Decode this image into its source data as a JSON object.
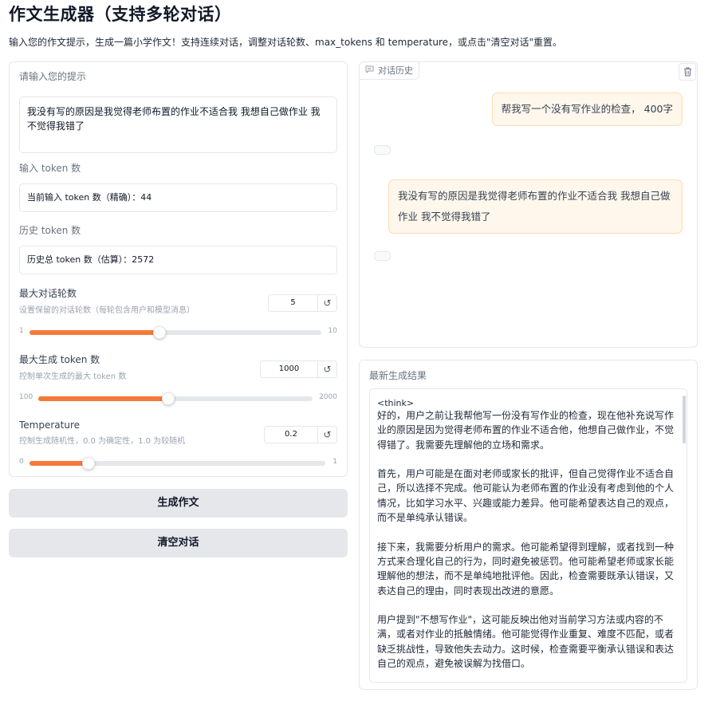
{
  "header": {
    "title": "作文生成器（支持多轮对话）",
    "subtitle": "输入您的作文提示，生成一篇小学作文！支持连续对话，调整对话轮数、max_tokens 和 temperature，或点击\"清空对话\"重置。"
  },
  "prompt": {
    "label": "请输入您的提示",
    "value": "我没有写的原因是我觉得老师布置的作业不适合我 我想自己做作业 我不觉得我错了"
  },
  "input_tokens": {
    "label": "输入 token 数",
    "value": "当前输入 token 数（精确）：44"
  },
  "history_tokens": {
    "label": "历史 token 数",
    "value": "历史总 token 数（估算）：2572"
  },
  "sliders": [
    {
      "label": "最大对话轮数",
      "info": "设置保留的对话轮数（每轮包含用户和模型消息）",
      "value": "5",
      "min": "1",
      "max": "10",
      "fraction": 0.4444
    },
    {
      "label": "最大生成 token 数",
      "info": "控制单次生成的最大 token 数",
      "value": "1000",
      "min": "100",
      "max": "2000",
      "fraction": 0.4737
    },
    {
      "label": "Temperature",
      "info": "控制生成随机性，0.0 为确定性，1.0 为较随机",
      "value": "0.2",
      "min": "0",
      "max": "1",
      "fraction": 0.2
    }
  ],
  "buttons": {
    "generate": "生成作文",
    "clear": "清空对话"
  },
  "chat": {
    "label": "对话历史",
    "icons": {
      "tag": "chat-bubble-icon",
      "clear": "trash-icon"
    },
    "messages": [
      {
        "role": "user",
        "text": "帮我写一个没有写作业的检查， 400字"
      },
      {
        "role": "assistant",
        "text": ""
      },
      {
        "role": "user",
        "text": "我没有写的原因是我觉得老师布置的作业不适合我 我想自己做作业 我不觉得我错了"
      },
      {
        "role": "assistant",
        "text": ""
      }
    ]
  },
  "result": {
    "label": "最新生成结果",
    "think_tag": "<think>",
    "text": "好的，用户之前让我帮他写一份没有写作业的检查，现在他补充说写作业的原因是因为觉得老师布置的作业不适合他，他想自己做作业，不觉得错了。我需要先理解他的立场和需求。\n\n首先，用户可能是在面对老师或家长的批评，但自己觉得作业不适合自己，所以选择不完成。他可能认为老师布置的作业没有考虑到他的个人情况，比如学习水平、兴趣或能力差异。他可能希望表达自己的观点，而不是单纯承认错误。\n\n接下来，我需要分析用户的需求。他可能希望得到理解，或者找到一种方式来合理化自己的行为，同时避免被惩罚。他可能希望老师或家长能理解他的想法，而不是单纯地批评他。因此，检查需要既承认错误，又表达自己的理由，同时表现出改进的意愿。\n\n用户提到\"不想写作业\"，这可能反映出他对当前学习方法或内容的不满，或者对作业的抵触情绪。他可能觉得作业重复、难度不匹配，或者缺乏挑战性，导致他失去动力。这时候，检查需要平衡承认错误和表达自己的观点，避免被误解为找借口。\n\n另外，用户可能希望老师能调整作业内容，或者给予更多自主权。因"
  }
}
